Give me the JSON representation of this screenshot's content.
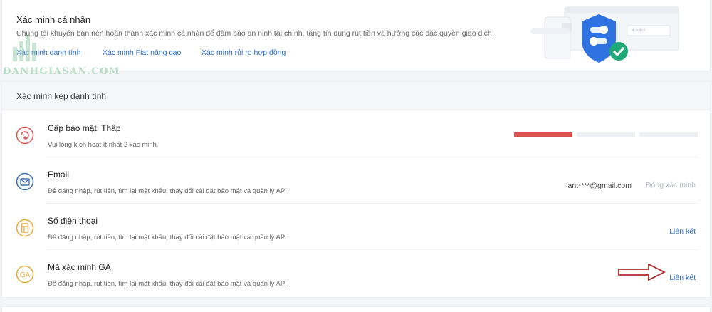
{
  "personal": {
    "title": "Xác minh cá nhân",
    "description": "Chúng tôi khuyến bạn nên hoàn thành xác minh cá nhân để đảm bảo an ninh tài chính, tăng tín dụng rút tiền và hưởng các đặc quyền giao dịch.",
    "links": [
      "Xác minh danh tính",
      "Xác minh Fiat nâng cao",
      "Xác minh rủi ro hợp đồng"
    ]
  },
  "watermark": {
    "text": "DANHGIASAN.COM"
  },
  "two_factor": {
    "header": "Xác minh kép danh tính",
    "security": {
      "title": "Cấp bảo mật: Thấp",
      "description": "Vui lòng kích hoạt ít nhất 2 xác minh.",
      "level_filled": 1,
      "level_total": 3
    },
    "email": {
      "title": "Email",
      "description": "Để đăng nhập, rút tiền, tìm lại mật khẩu, thay đổi cài đặt bảo mật và quản lý API.",
      "value": "ant****@gmail.com",
      "action": "Đóng xác minh"
    },
    "phone": {
      "title": "Số điện thoại",
      "description": "Để đăng nhập, rút tiền, tìm lại mật khẩu, thay đổi cài đặt bảo mật và quản lý API.",
      "action": "Liên kết"
    },
    "ga": {
      "title": "Mã xác minh GA",
      "description": "Để đăng nhập, rút tiền, tìm lại mật khẩu, thay đổi cài đặt bảo mật và quản lý API.",
      "action": "Liên kết",
      "icon_text": "GA"
    }
  },
  "colors": {
    "link": "#2d6fd6",
    "danger": "#d9534f",
    "email_icon": "#3a6fb0",
    "phone_icon": "#e8a93a",
    "shield": "#2f73e0",
    "check": "#1fa978",
    "arrow": "#b22a2a"
  },
  "icons": [
    "security-level-icon",
    "email-icon",
    "phone-icon",
    "ga-icon",
    "shield-check-icon",
    "arrow-icon"
  ],
  "illustration_text": "****"
}
